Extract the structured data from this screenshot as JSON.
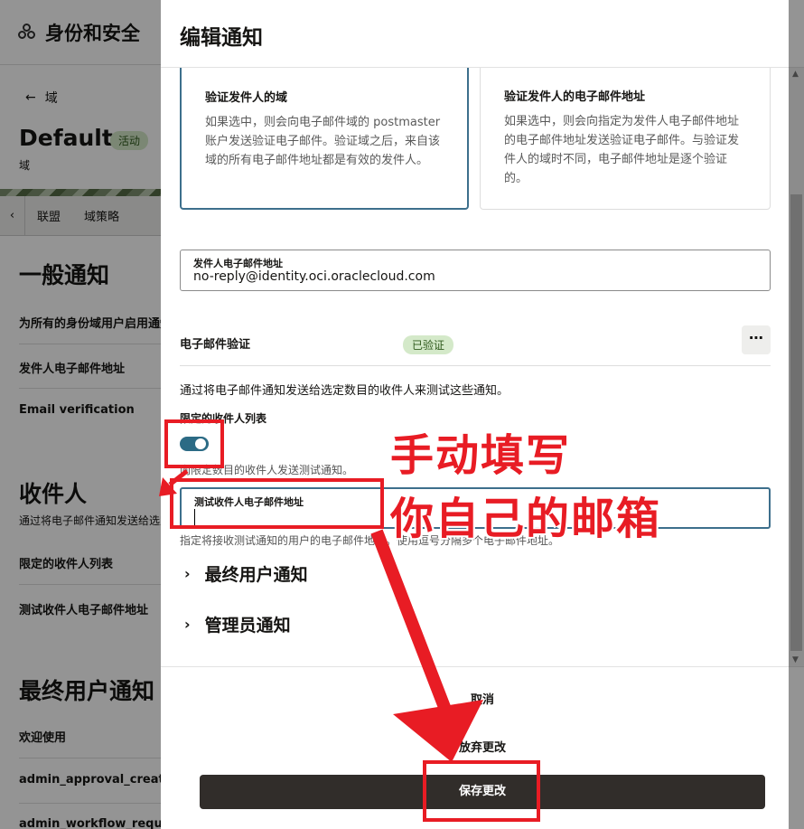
{
  "background": {
    "app_title": "身份和安全",
    "back_label": "域",
    "domain_name": "Default",
    "domain_status": "活动",
    "domain_type": "域",
    "tabs": [
      "联盟",
      "域策略"
    ],
    "section_general": "一般通知",
    "general_rows": [
      "为所有的身份域用户启用通知",
      "发件人电子邮件地址",
      "Email verification"
    ],
    "section_recipients": "收件人",
    "recipients_desc": "通过将电子邮件通知发送给选定数目的收件人来测试这些通知。",
    "recipient_rows": [
      "限定的收件人列表",
      "测试收件人电子邮件地址"
    ],
    "section_enduser": "最终用户通知",
    "enduser_rows": [
      "欢迎使用",
      "admin_approval_create_user",
      "admin_workflow_request"
    ]
  },
  "drawer": {
    "title": "编辑通知",
    "card_domain": {
      "title": "验证发件人的域",
      "desc": "如果选中，则会向电子邮件域的 postmaster 账户发送验证电子邮件。验证域之后，来自该域的所有电子邮件地址都是有效的发件人。"
    },
    "card_email": {
      "title": "验证发件人的电子邮件地址",
      "desc": "如果选中，则会向指定为发件人电子邮件地址的电子邮件地址发送验证电子邮件。与验证发件人的域时不同，电子邮件地址是逐个验证的。"
    },
    "sender_field": {
      "label": "发件人电子邮件地址",
      "value": "no-reply@identity.oci.oraclecloud.com"
    },
    "email_verification_label": "电子邮件验证",
    "verified_badge": "已验证",
    "test_desc": "通过将电子邮件通知发送给选定数目的收件人来测试这些通知。",
    "limited_list_label": "限定的收件人列表",
    "toggle_on": true,
    "toggle_hint": "向限定数目的收件人发送测试通知。",
    "test_field": {
      "label": "测试收件人电子邮件地址",
      "value": ""
    },
    "test_field_hint": "指定将接收测试通知的用户的电子邮件地址。使用逗号分隔多个电子邮件地址。",
    "accordion": [
      "最终用户通知",
      "管理员通知"
    ],
    "cancel_label": "取消",
    "discard_label": "放弃更改",
    "save_label": "保存更改"
  },
  "annotations": {
    "line1": "手动填写",
    "line2": "你自己的邮箱",
    "color": "#e81c24"
  }
}
